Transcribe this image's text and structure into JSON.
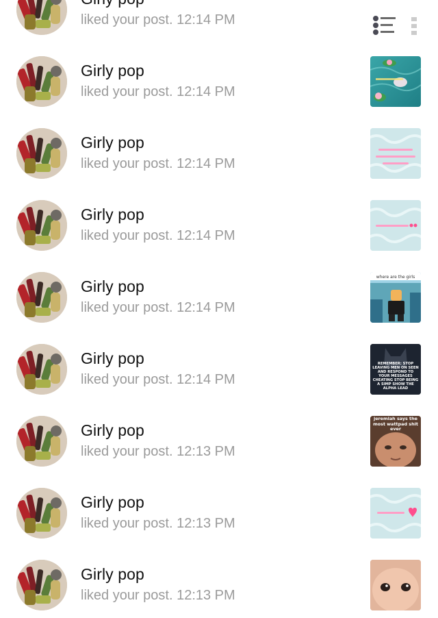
{
  "notifications": [
    {
      "user": "Girly pop",
      "action": "liked your post.",
      "time": "12:14 PM",
      "thumb": "screenshot"
    },
    {
      "user": "Girly pop",
      "action": "liked your post.",
      "time": "12:14 PM",
      "thumb": "lilypad"
    },
    {
      "user": "Girly pop",
      "action": "liked your post.",
      "time": "12:14 PM",
      "thumb": "swirl-three-lines"
    },
    {
      "user": "Girly pop",
      "action": "liked your post.",
      "time": "12:14 PM",
      "thumb": "swirl-one-line"
    },
    {
      "user": "Girly pop",
      "action": "liked your post.",
      "time": "12:14 PM",
      "thumb": "game-avatar"
    },
    {
      "user": "Girly pop",
      "action": "liked your post.",
      "time": "12:14 PM",
      "thumb": "wolf-meme"
    },
    {
      "user": "Girly pop",
      "action": "liked your post.",
      "time": "12:13 PM",
      "thumb": "face-meme"
    },
    {
      "user": "Girly pop",
      "action": "liked your post.",
      "time": "12:13 PM",
      "thumb": "swirl-heart"
    },
    {
      "user": "Girly pop",
      "action": "liked your post.",
      "time": "12:13 PM",
      "thumb": "baby-face"
    }
  ],
  "thumb_text": {
    "game_caption": "where are the girls",
    "wolf_caption": "REMEMBER: STOP LEAVING MEN ON SEEN AND RESPOND TO YOUR MESSAGES CHEATING STOP BEING A SIMP SHOW THE ALPHA LEAD",
    "face_caption": "jeremiah says the most wattpad shit ever"
  },
  "colors": {
    "name": "#111111",
    "meta": "#9a9a9a",
    "swirl_bg": "#cfe7ea",
    "pink_text": "#ff7fb3",
    "heart": "#ff4d8d"
  }
}
